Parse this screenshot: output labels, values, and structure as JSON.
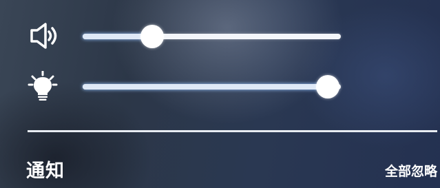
{
  "quick_settings": {
    "volume": {
      "icon": "speaker-icon",
      "level_fraction": 0.27
    },
    "brightness": {
      "icon": "bulb-icon",
      "level_fraction": 0.95
    }
  },
  "notifications": {
    "title": "通知",
    "dismiss_all_label": "全部忽略"
  }
}
